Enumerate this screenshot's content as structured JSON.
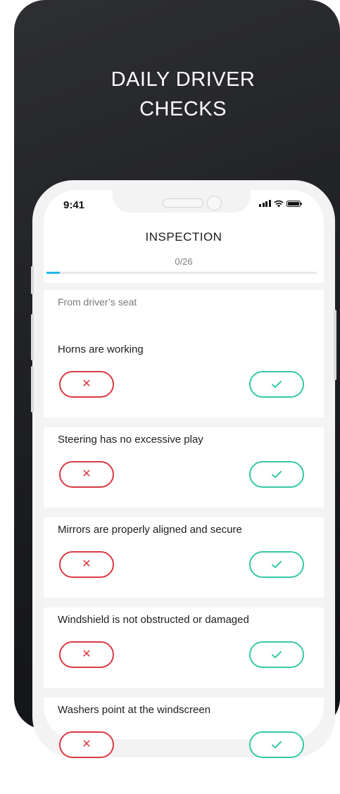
{
  "promo": {
    "headline_line1": "DAILY DRIVER",
    "headline_line2": "CHECKS"
  },
  "status_bar": {
    "time": "9:41",
    "icons": [
      "signal-bars-icon",
      "wifi-icon",
      "battery-icon"
    ]
  },
  "screen": {
    "title": "INSPECTION",
    "progress_text": "0/26",
    "progress_value": 0,
    "progress_total": 26,
    "section_label": "From driver’s seat"
  },
  "checklist": {
    "items": [
      {
        "label": "Horns are working"
      },
      {
        "label": "Steering has no excessive play"
      },
      {
        "label": "Mirrors are properly aligned and secure"
      },
      {
        "label": "Windshield is not obstructed or damaged"
      },
      {
        "label": "Washers point at the windscreen"
      }
    ],
    "fail_icon": "x-icon",
    "pass_icon": "check-icon"
  },
  "colors": {
    "background_dark": "#1f2024",
    "accent_blue": "#24b6e8",
    "fail_red": "#dc3a44",
    "pass_green": "#36c9a4"
  }
}
